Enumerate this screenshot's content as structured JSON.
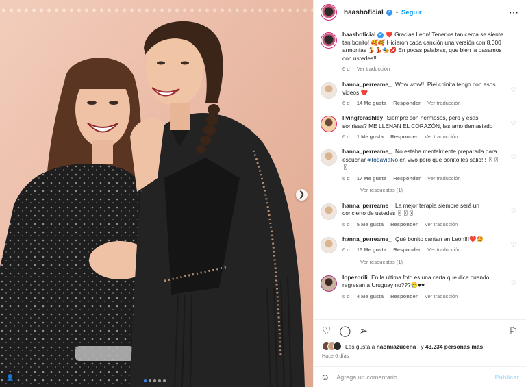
{
  "post": {
    "username": "haashoficial",
    "follow_label": "Seguir",
    "separator": "•",
    "more_icon": "more-horizontal-icon",
    "carousel": {
      "dots": 5,
      "active": 0
    }
  },
  "caption": {
    "username": "haashoficial",
    "text": "Gracias Leon! Tenerlos tan cerca se siente tan bonito! 🥰🥰 Hicieron cada canción una versión con 8.000 armonías 💃💃🎭💋 En pocas palabras, que bien la pasamos con ustedes!!",
    "lead_emoji": "❤️",
    "time": "6 d",
    "translate": "Ver traducción"
  },
  "comments": [
    {
      "username": "hanna_perreame_",
      "text": "Wow wow!!! Piel chinita tengo con esos videos ❤️",
      "time": "6 d",
      "likes": "14 Me gusta",
      "reply": "Responder",
      "translate": "Ver traducción"
    },
    {
      "username": "livingforashley",
      "text": "Siempre son hermosos, pero y esas sonrisas? ME LLENAN EL CORAZÓN, las amo demasiado",
      "time": "6 d",
      "likes": "1 Me gusta",
      "reply": "Responder",
      "translate": "Ver traducción"
    },
    {
      "username": "hanna_perreame_",
      "text_before": "No estaba mentalmente preparada para escuchar ",
      "hashtag": "#TodavíaNo",
      "text_after": " en vivo pero qué bonito les salió!!! 〿〿〿",
      "time": "6 d",
      "likes": "17 Me gusta",
      "reply": "Responder",
      "translate": "Ver traducción",
      "view_replies": "Ver respuestas (1)"
    },
    {
      "username": "hanna_perreame_",
      "text": "La mejor terapia siempre será un concierto de ustedes 〿〿〿",
      "time": "6 d",
      "likes": "5 Me gusta",
      "reply": "Responder",
      "translate": "Ver traducción"
    },
    {
      "username": "hanna_perreame_",
      "text": "Qué bonito cantan en León!!!❤️🤩",
      "time": "6 d",
      "likes": "15 Me gusta",
      "reply": "Responder",
      "translate": "Ver traducción",
      "view_replies": "Ver respuestas (1)"
    },
    {
      "username": "lopezorili",
      "text": "En la ultima foto es una carta que dice cuando regresan a Uruguay no???🥲♥♥",
      "time": "6 d",
      "likes": "4 Me gusta",
      "reply": "Responder",
      "translate": "Ver traducción"
    }
  ],
  "actions": {
    "icons": [
      "heart-icon",
      "comment-icon",
      "share-icon",
      "bookmark-icon"
    ],
    "likes_prefix": "Les gusta a ",
    "likes_user": "naomiazucena_",
    "likes_middle": " y ",
    "likes_count": "43.234 personas más",
    "posted_ago": "Hace 6 días"
  },
  "composer": {
    "placeholder": "Agrega un comentario...",
    "publish_label": "Publicar"
  },
  "colors": {
    "accent": "#0095f6",
    "heart": "#ed4956",
    "verified": "#3897f0"
  }
}
